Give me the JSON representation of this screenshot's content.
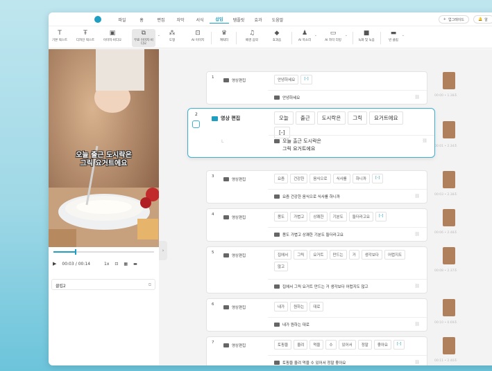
{
  "menu": {
    "items": [
      "파일",
      "홈",
      "편집",
      "자막",
      "서식",
      "삽입",
      "템플릿",
      "효과",
      "도움말"
    ],
    "active_index": 5,
    "upgrade_label": "업그레이드",
    "user_label": "알"
  },
  "toolbar": {
    "items": [
      {
        "label": "기본 텍스트",
        "icon": "text-icon"
      },
      {
        "label": "디자인 텍스트",
        "icon": "design-text-icon"
      },
      {
        "label": "이미지·비디오",
        "icon": "image-video-icon"
      },
      {
        "label": "무료 이미지·비디오",
        "icon": "free-image-icon"
      },
      {
        "label": "도형",
        "icon": "shape-icon"
      },
      {
        "label": "AI 이미지",
        "icon": "ai-image-icon"
      },
      {
        "label": "캐릭터",
        "icon": "character-icon"
      },
      {
        "label": "배경 음악",
        "icon": "music-icon"
      },
      {
        "label": "효과음",
        "icon": "sound-effect-icon"
      },
      {
        "label": "AI 목소리",
        "icon": "ai-voice-icon"
      },
      {
        "label": "AI 자막 더빙",
        "icon": "ai-dubbing-icon"
      },
      {
        "label": "녹화 및 녹음",
        "icon": "record-icon"
      },
      {
        "label": "빈 클립",
        "icon": "blank-clip-icon"
      }
    ]
  },
  "player": {
    "caption_line1": "오늘 출근 도시락은",
    "caption_line2": "그릭 요거트에요",
    "progress": 0.214,
    "time_current": "00:03",
    "time_separator": "/",
    "time_total": "00:14",
    "speed": "1x",
    "clip_name": "클립2"
  },
  "rows": [
    {
      "num": "1",
      "badge": "영상편집",
      "words": [
        "안녕하세요",
        "[-]"
      ],
      "subtitle": "안녕하세요",
      "time": "00:00 • 1.38초"
    },
    {
      "num": "2",
      "badge": "영상 편집",
      "words": [
        "오늘",
        "출근",
        "도시락은",
        "그릭",
        "요거트에요",
        "[-]"
      ],
      "subtitle_line1": "오늘 출근 도시락은",
      "subtitle_line2": "그릭 요거트에요",
      "mark": "L",
      "time": "00:01 • 2.34초"
    },
    {
      "num": "3",
      "badge": "영상편집",
      "words": [
        "요즘",
        "건강한",
        "음식으로",
        "식사를",
        "하니까",
        "[-]"
      ],
      "subtitle": "요즘 건강한 음식으로 식사를 하니까",
      "time": "00:03 • 2.38초"
    },
    {
      "num": "4",
      "badge": "영상편집",
      "words": [
        "몸도",
        "가볍고",
        "상쾌한",
        "기분도",
        "들더라고요",
        "[-]"
      ],
      "subtitle": "몸도 가볍고 상쾌한 기분도 들더라고요",
      "time": "00:06 • 2.48초"
    },
    {
      "num": "5",
      "badge": "영상편집",
      "words": [
        "집에서",
        "그릭",
        "요거트",
        "만드는",
        "거",
        "생각보다",
        "어렵지도",
        "않고"
      ],
      "subtitle": "집에서 그릭 요거트 만드는 거 생각보다 어렵지도 않고",
      "time": "00:08 • 2.37초"
    },
    {
      "num": "6",
      "badge": "영상편집",
      "words": [
        "내가",
        "원하는",
        "대로"
      ],
      "subtitle": "내가 원하는 대로",
      "time": "00:10 • 0.69초"
    },
    {
      "num": "7",
      "badge": "영상편집",
      "words": [
        "토핑을",
        "올려",
        "먹을",
        "수",
        "있어서",
        "정말",
        "좋아요",
        "[-]"
      ],
      "subtitle": "토핑을 올려 먹을 수 있어서 정말 좋아요",
      "time": "00:11 • 2.40초"
    }
  ],
  "colors": {
    "accent": "#1e9ec0",
    "focus_border": "#3bb1cf",
    "background": "#9fd8e6"
  }
}
